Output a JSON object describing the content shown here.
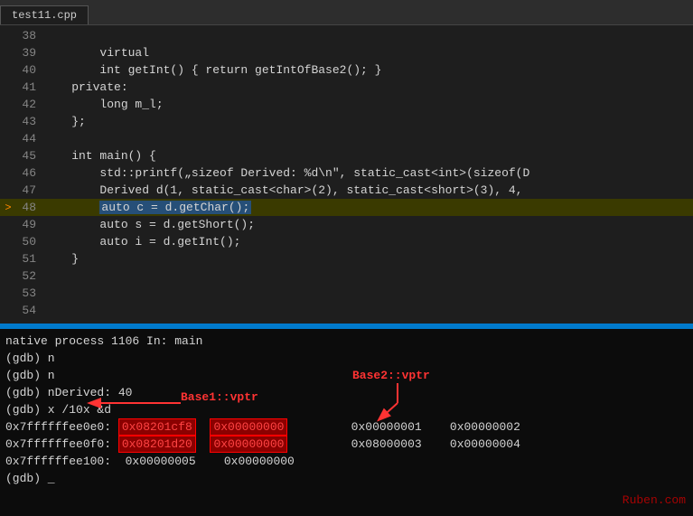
{
  "tab": {
    "label": "test11.cpp"
  },
  "code_lines": [
    {
      "num": "38",
      "content": "",
      "arrow": false,
      "highlighted": false
    },
    {
      "num": "39",
      "content": "        virtual",
      "arrow": false,
      "highlighted": false
    },
    {
      "num": "40",
      "content": "        int getInt() { return getIntOfBase2(); }",
      "arrow": false,
      "highlighted": false
    },
    {
      "num": "41",
      "content": "    private:",
      "arrow": false,
      "highlighted": false
    },
    {
      "num": "42",
      "content": "        long m_l;",
      "arrow": false,
      "highlighted": false
    },
    {
      "num": "43",
      "content": "    };",
      "arrow": false,
      "highlighted": false
    },
    {
      "num": "44",
      "content": "",
      "arrow": false,
      "highlighted": false
    },
    {
      "num": "45",
      "content": "    int main() {",
      "arrow": false,
      "highlighted": false
    },
    {
      "num": "46",
      "content": "        std::printf(„sizeof Derived: %d\\n\", static_cast<int>(sizeof(D",
      "arrow": false,
      "highlighted": false
    },
    {
      "num": "47",
      "content": "        Derived d(1, static_cast<char>(2), static_cast<short>(3), 4,",
      "arrow": false,
      "highlighted": false
    },
    {
      "num": "48",
      "content": "        auto c = d.getChar();",
      "arrow": true,
      "highlighted": true
    },
    {
      "num": "49",
      "content": "        auto s = d.getShort();",
      "arrow": false,
      "highlighted": false
    },
    {
      "num": "50",
      "content": "        auto i = d.getInt();",
      "arrow": false,
      "highlighted": false
    },
    {
      "num": "51",
      "content": "    }",
      "arrow": false,
      "highlighted": false
    },
    {
      "num": "52",
      "content": "",
      "arrow": false,
      "highlighted": false
    },
    {
      "num": "53",
      "content": "",
      "arrow": false,
      "highlighted": false
    },
    {
      "num": "54",
      "content": "",
      "arrow": false,
      "highlighted": false
    }
  ],
  "terminal": {
    "status_line": "native process 1106 In: main",
    "lines": [
      {
        "text": "(gdb) n"
      },
      {
        "text": "(gdb) n"
      },
      {
        "text": "(gdb) nDerived: 40"
      },
      {
        "text": "(gdb) x /10x &d"
      },
      {
        "text": "0x7ffffffee0e0:  0x08201cf8    0x00000000         0x00000001    0x00000002"
      },
      {
        "text": "0x7ffffffee0f0:  0x08201d20    0x00000000         0x08000003    0x00000004"
      },
      {
        "text": "0x7ffffffee100:  0x00000005    0x00000000"
      },
      {
        "text": "(gdb) _"
      }
    ],
    "annotation_base1": "Base1::vptr",
    "annotation_base2": "Base2::vptr",
    "highlighted_cells": {
      "row0": [
        "0x08201cf8",
        "0x00000000"
      ],
      "row1": [
        "0x08201d20",
        "0x00000000"
      ]
    },
    "watermark": "Ruben.com"
  }
}
